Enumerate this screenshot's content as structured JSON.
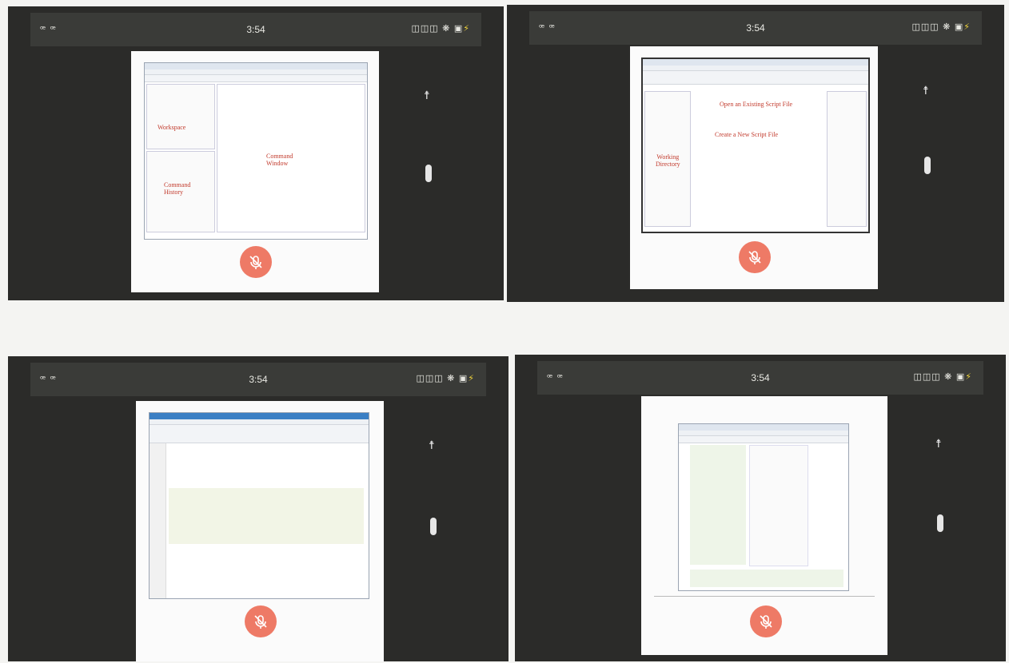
{
  "status_bar": {
    "left_icons": "ꟹ ꟹ",
    "time": "3:54",
    "right_icons": "◫◫◫ ❋ ▣",
    "bolt": "⚡"
  },
  "panels": [
    {
      "annotations": {
        "workspace": "Workspace",
        "command_window": "Command\nWindow",
        "command_history": "Command\nHistory"
      }
    },
    {
      "annotations": {
        "open_script": "Open an Existing Script File",
        "new_script": "Create a New Script File",
        "working_dir": "Working\nDirectory"
      }
    },
    {},
    {}
  ],
  "icons": {
    "mic": "mic-off-icon",
    "side_top": "accessibility-icon",
    "side_mid": "pill-icon"
  },
  "colors": {
    "panel_bg": "#2b2b29",
    "statusbar_bg": "#3a3b38",
    "mic_bg": "#ee7a66",
    "annotation": "#c23a2c"
  }
}
